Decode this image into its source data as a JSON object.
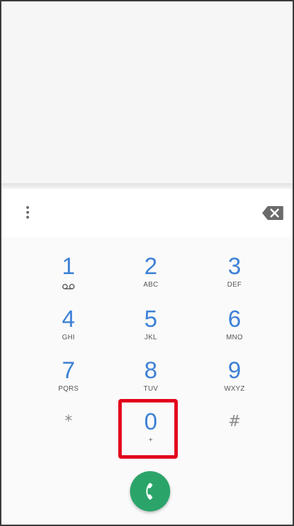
{
  "keypad": {
    "keys": [
      {
        "digit": "1",
        "letters": "",
        "voicemail_icon": "voicemail-icon"
      },
      {
        "digit": "2",
        "letters": "ABC"
      },
      {
        "digit": "3",
        "letters": "DEF"
      },
      {
        "digit": "4",
        "letters": "GHI"
      },
      {
        "digit": "5",
        "letters": "JKL"
      },
      {
        "digit": "6",
        "letters": "MNO"
      },
      {
        "digit": "7",
        "letters": "PQRS"
      },
      {
        "digit": "8",
        "letters": "TUV"
      },
      {
        "digit": "9",
        "letters": "WXYZ"
      },
      {
        "symbol": "*"
      },
      {
        "digit": "0",
        "letters": "+"
      },
      {
        "symbol": "#"
      }
    ]
  },
  "icons": {
    "overflow": "more-vertical-icon",
    "backspace": "backspace-icon",
    "call": "phone-icon"
  },
  "colors": {
    "digit": "#3e82d6",
    "call_button": "#2ba46a",
    "highlight": "#e3001b"
  }
}
